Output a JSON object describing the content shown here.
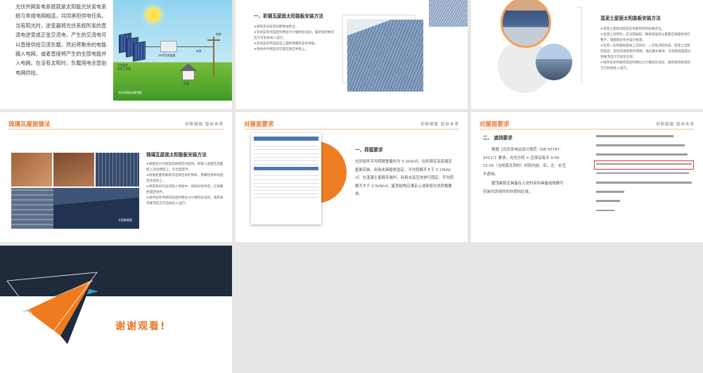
{
  "slide1": {
    "text": "光伏并网发电系统就是太阳能光伏发电系统与常规电网相连，共同承担供电任务。当有阳光时，逆变器将光伏系统所发的直流电逆变成正弦交流电，产生的交流电可以直接供给交流负载，然后将剩余的电能输入电网，或者直接将产生的全部电能并入电网。在没有太阳时，负载用电全部由电网供给。",
    "diagram": {
      "label_panels": "光伏组件",
      "label_panel_sub": "光伏汇流箱",
      "label_inverter": "SN光伏逆变器",
      "label_meter": "电表",
      "label_grid": "电网",
      "label_load": "负载",
      "caption": "光伏并网发电原理图"
    }
  },
  "slide2": {
    "title": "一、彩钢瓦屋面太阳能板安装方法",
    "items": [
      "➤导轨夹具安装前底致线定位。",
      "➤夹具安装完成后利用拉力计做检验试验，满足规范要求后方可验收投入运行。",
      "➤夹具安装完成后在上面利用螺栓安装导轨。",
      "➤将组件利用压块可靠压接在导轨上。"
    ]
  },
  "slide3": {
    "title": "混泥土屋面太阳能板安装方法",
    "items": [
      "➤混泥土基础浇筑前应先做现场夹层做定位。",
      "➤混泥土浇筑时，应对其振捣，确保其强度分量面在规图标进行整齐，满面值达符合设计规定。",
      "➤在同一支架基础基层上浇筑时，一次性浇筑完成。混泥土浇筑完成后，及时的采取养护措施，抛光磨水期承，支架基础强度达到要求后方可安装支架。",
      "➤组件安装伴随完成后利用拉力计做检验试验，满足规范要求后方可验收投入运行。"
    ]
  },
  "slide4": {
    "header_title": "琉璃瓦屋面做法",
    "header_tag": "创新赋能 智启未来",
    "title": "琉璃瓦屋面太阳能板安装方法",
    "watermark": "太阳能屋面",
    "items": [
      "➤根据瓦片的类型选择相应的挂钩，根据入屋面瓦后面留上选合相挂上，引出固定件。",
      "➤根据屋面荷载要求选择合适的导轨，用螺栓将导轨固定在挂钩上。",
      "➤将安装好的压块放入导轨中，按照好组件后，拧紧螺栓固定组件。",
      "➤组件安装伴随完成后利用拉力计做检验试验，满足规范要求后方可验收投入运行。"
    ]
  },
  "slide5": {
    "header_title": "对屋面要求",
    "header_tag": "创新赋能 智启未来",
    "title": "一、荷载要求",
    "text": "光伏组件平均荷载重量约为 0.1kN/㎡。在彩钢瓦及琉璃瓦屋面安装，利用夹具檩条固定，平均荷载不大于 0.15kN/㎡。在混凝土屋面安装时，利用水泥压块进行固定，平均荷载不大于 0.5kN/㎡。屋顶结构应满足上述新增光伏荷载要求。"
  },
  "slide6": {
    "header_title": "对屋面要求",
    "header_tag": "创新赋能 智启未来",
    "title": "二、 遮挡要求",
    "text": "根据《光伏发电站设计规范（GB 50797-2012）》要求，光伏方阵 = 应保证每天 9:00-15:00（当地真太阳时）时段内前、后、左、右互不遮挡。",
    "text2": "屋顶建筑应具备在上述时间内具备成规模可安装光伏组件的非遮挡区域。"
  },
  "slide7": {
    "title": "谢谢观看!"
  }
}
